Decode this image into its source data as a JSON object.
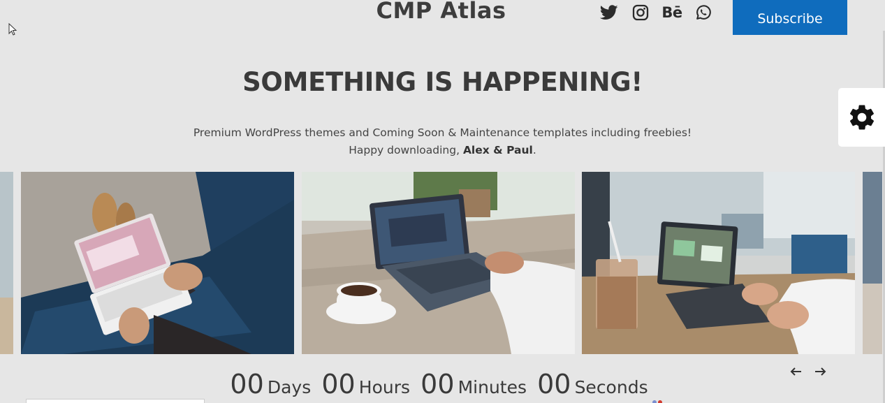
{
  "header": {
    "brand": "CMP Atlas",
    "subscribe_label": "Subscribe",
    "social": [
      {
        "icon": "twitter-icon"
      },
      {
        "icon": "instagram-icon"
      },
      {
        "icon": "behance-icon",
        "glyph": "Bē"
      },
      {
        "icon": "whatsapp-icon"
      }
    ]
  },
  "hero": {
    "headline": "SOMETHING IS HAPPENING!",
    "line1": "Premium WordPress themes and Coming Soon & Maintenance templates including freebies!",
    "line2_prefix": "Happy downloading, ",
    "line2_bold": "Alex & Paul",
    "line2_suffix": "."
  },
  "countdown": {
    "days_value": "00",
    "days_label": "Days",
    "hours_value": "00",
    "hours_label": "Hours",
    "minutes_value": "00",
    "minutes_label": "Minutes",
    "seconds_value": "00",
    "seconds_label": "Seconds"
  },
  "colors": {
    "background": "#e6e6e6",
    "accent": "#0f6cbd",
    "text": "#3a3a3a"
  }
}
